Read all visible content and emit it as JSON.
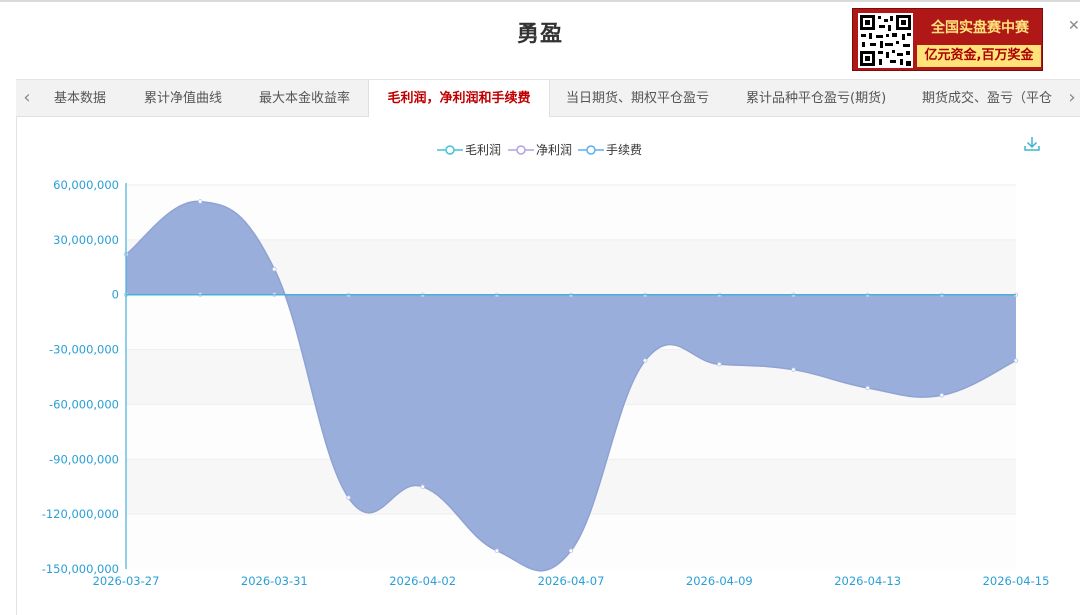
{
  "page": {
    "title": "勇盈"
  },
  "ad": {
    "line1": "全国实盘赛中赛",
    "line2": "亿元资金,百万奖金"
  },
  "tabs": [
    {
      "label": "基本数据",
      "active": false
    },
    {
      "label": "累计净值曲线",
      "active": false
    },
    {
      "label": "最大本金收益率",
      "active": false
    },
    {
      "label": "毛利润，净利润和手续费",
      "active": true
    },
    {
      "label": "当日期货、期权平仓盈亏",
      "active": false
    },
    {
      "label": "累计品种平仓盈亏(期货)",
      "active": false
    },
    {
      "label": "期货成交、盈亏（平仓",
      "active": false
    }
  ],
  "icons": {
    "prev": "chevron-left-icon",
    "next": "chevron-right-icon",
    "download": "download-icon",
    "close": "close-icon"
  },
  "chart_data": {
    "type": "area",
    "title": "",
    "xlabel": "",
    "ylabel": "",
    "ylim": [
      -150000000,
      60000000
    ],
    "yticks": [
      60000000,
      30000000,
      0,
      -30000000,
      -60000000,
      -90000000,
      -120000000,
      -150000000
    ],
    "ytick_labels": [
      "60,000,000",
      "30,000,000",
      "0",
      "-30,000,000",
      "-60,000,000",
      "-90,000,000",
      "-120,000,000",
      "-150,000,000"
    ],
    "x_tick_labels": [
      "2026-03-27",
      "2026-03-31",
      "2026-04-02",
      "2026-04-07",
      "2026-04-09",
      "2026-04-13",
      "2026-04-15"
    ],
    "legend_position": "top-center",
    "grid": true,
    "series": [
      {
        "name": "毛利润",
        "color": "#44c3d8",
        "values": [
          22000000,
          51000000,
          14000000,
          -111000000,
          -105000000,
          -140000000,
          -140000000,
          -36000000,
          -38000000,
          -41000000,
          -51000000,
          -55000000,
          -36000000
        ]
      },
      {
        "name": "净利润",
        "color": "#b6a2de",
        "values": [
          0,
          0,
          0,
          0,
          0,
          0,
          0,
          0,
          0,
          0,
          0,
          0,
          0
        ]
      },
      {
        "name": "手续费",
        "color": "#5ab1ef",
        "values": [
          0,
          0,
          0,
          0,
          0,
          0,
          0,
          0,
          0,
          0,
          0,
          0,
          0
        ]
      }
    ],
    "area_color": "#9aaedb"
  }
}
